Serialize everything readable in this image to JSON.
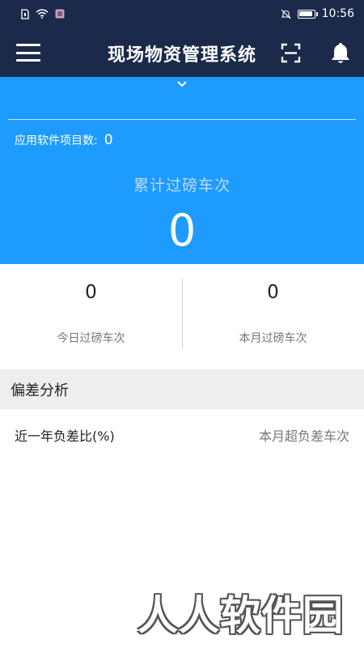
{
  "status_bar": {
    "time": "10:56",
    "icons": [
      "sim-icon",
      "wifi-icon",
      "app-notification-icon",
      "mute-icon",
      "battery-icon"
    ]
  },
  "app_bar": {
    "title": "现场物资管理系统",
    "left_icon": "menu-icon",
    "right_icons": [
      "scan-icon",
      "bell-icon"
    ]
  },
  "hero": {
    "project_count_label": "应用软件项目数:",
    "project_count_value": "0",
    "total_label": "累计过磅车次",
    "total_value": "0",
    "colors": {
      "background": "#1e9bff",
      "label": "#b9dcff"
    }
  },
  "stats": {
    "today": {
      "value": "0",
      "label": "今日过磅车次"
    },
    "month": {
      "value": "0",
      "label": "本月过磅车次"
    }
  },
  "deviation": {
    "section_title": "偏差分析",
    "left_label": "近一年负差比(%)",
    "right_label": "本月超负差车次"
  },
  "watermark": {
    "text": "人人软件园"
  },
  "colors": {
    "header_bg": "#1b2a4a",
    "section_bg": "#eeeeee"
  }
}
